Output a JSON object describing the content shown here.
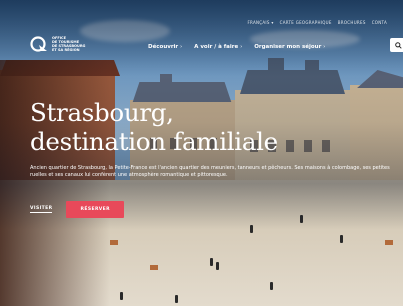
{
  "header": {
    "top_links": [
      "FRANÇAIS ▾",
      "CARTE GEOGRAPHIQUE",
      "BROCHURES",
      "CONTA"
    ],
    "logo_lines": [
      "OFFICE",
      "DE TOURISME",
      "DE STRASBOURG",
      "ET SA RÉGION"
    ],
    "nav": [
      {
        "label": "Découvrir",
        "chevron": "›"
      },
      {
        "label": "A voir / à faire",
        "chevron": "›"
      },
      {
        "label": "Organiser mon séjour",
        "chevron": "›"
      }
    ],
    "search_icon": "search-icon"
  },
  "hero": {
    "title_line1": "Strasbourg,",
    "title_line2": "destination familiale",
    "description": "Ancien quartier de Strasbourg, la Petite-France est l'ancien quartier des meuniers, tanneurs et pêcheurs. Ses maisons à colombage, ses petites ruelles et ses canaux lui confèrent une atmosphère romantique et pittoresque.",
    "link_label": "VISITER",
    "button_label": "RÉSERVER"
  },
  "colors": {
    "accent": "#e8495a",
    "text_on_image": "#ffffff"
  }
}
